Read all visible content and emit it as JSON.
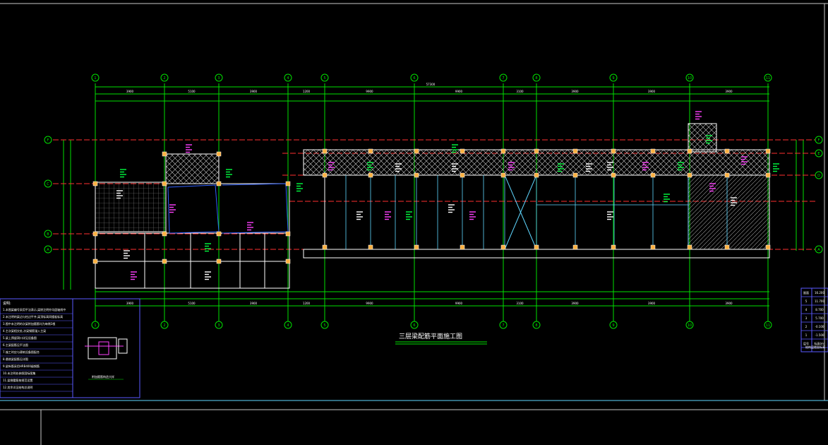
{
  "drawing": {
    "title": "三层梁配筋平面施工图",
    "axes_numbers": [
      "1",
      "2",
      "3",
      "4",
      "5",
      "6",
      "7",
      "8",
      "9",
      "10",
      "11"
    ],
    "axes_letters": [
      "F",
      "E",
      "D",
      "C",
      "B",
      "A"
    ],
    "top_dims_row1": [
      "3900",
      "5100",
      "3900",
      "1200",
      "9900",
      "9900",
      "3100",
      "3900",
      "3900",
      "3900"
    ],
    "bottom_dims_row1": [
      "3900",
      "5100",
      "3900",
      "1200",
      "9900",
      "9900",
      "3100",
      "3900",
      "3900",
      "3900"
    ],
    "top_total": "57300"
  },
  "floor_table": {
    "rows": [
      {
        "floor": "屋面",
        "elev": "16.200"
      },
      {
        "floor": "5",
        "elev": "11.700"
      },
      {
        "floor": "4",
        "elev": "8.700"
      },
      {
        "floor": "3",
        "elev": "5.700"
      },
      {
        "floor": "2",
        "elev": "-0.100"
      },
      {
        "floor": "1",
        "elev": "-1.500"
      },
      {
        "floor": "层号",
        "elev": "标高(m)"
      }
    ],
    "footer": "结构层楼面标高"
  },
  "notes": {
    "header": "说明:",
    "lines": [
      "1.本图梁编号采用平法表示,梁除注明外均居轴线中",
      "2.未注明的梁边与柱边平齐,梁顶标高同楼板标高",
      "3.图中未注明的次梁附加箍筋均为每侧3根",
      "4.主次梁相交处,次梁钢筋锚入主梁",
      "5.梁上预留洞口详见设备图",
      "6.主梁配筋见平法图",
      "7.施工时应与建筑设备图配合",
      "8.悬挑梁配筋见详图",
      "9.梁纵筋采用HRB400级钢筋",
      "10.未注明处参照国标图集",
      "11.梁侧腰筋按规范设置",
      "12.其余详见结构总说明"
    ],
    "detail_caption": "附加箍筋构造大样"
  }
}
